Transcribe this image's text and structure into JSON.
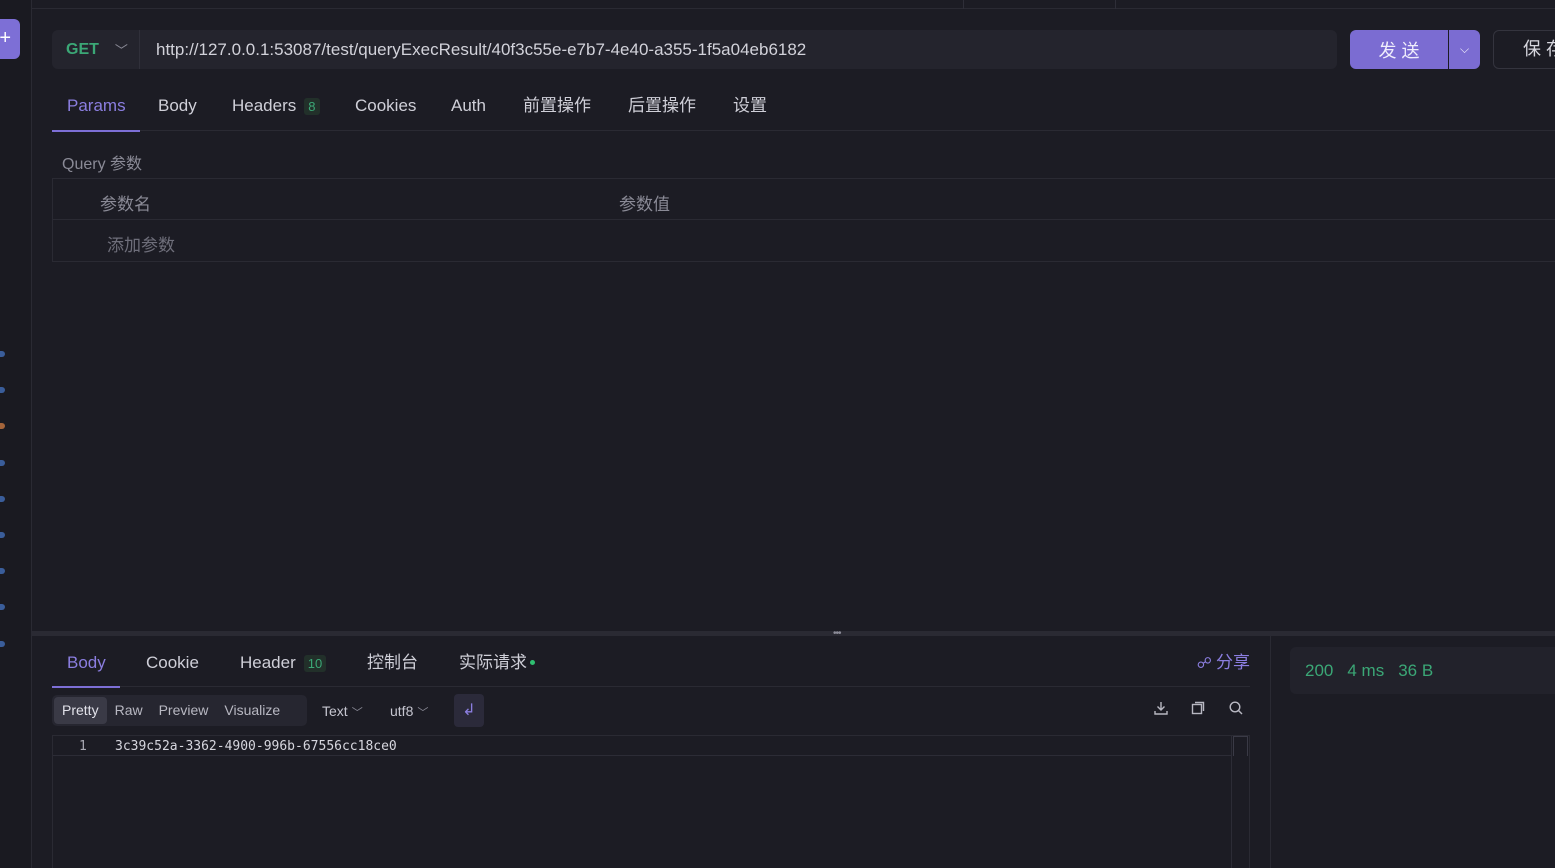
{
  "request": {
    "method": "GET",
    "url": "http://127.0.0.1:53087/test/queryExecResult/40f3c55e-e7b7-4e40-a355-1f5a04eb6182",
    "send_label": "发 送",
    "save_label": "保 存"
  },
  "request_tabs": {
    "params": "Params",
    "body": "Body",
    "headers": "Headers",
    "headers_count": "8",
    "cookies": "Cookies",
    "auth": "Auth",
    "pre_ops": "前置操作",
    "post_ops": "后置操作",
    "settings": "设置"
  },
  "query": {
    "title": "Query 参数",
    "col_name": "参数名",
    "col_value": "参数值",
    "add_placeholder": "添加参数"
  },
  "response_tabs": {
    "body": "Body",
    "cookie": "Cookie",
    "header": "Header",
    "header_count": "10",
    "console": "控制台",
    "actual_request": "实际请求",
    "share": "分享"
  },
  "view_modes": {
    "pretty": "Pretty",
    "raw": "Raw",
    "preview": "Preview",
    "visualize": "Visualize",
    "format": "Text",
    "encoding": "utf8"
  },
  "editor": {
    "line_number": "1",
    "content": "3c39c52a-3362-4900-996b-67556cc18ce0"
  },
  "status": {
    "code": "200",
    "time": "4 ms",
    "size": "36 B"
  },
  "colors": {
    "accent": "#7b6cd2",
    "success": "#3ba776",
    "background": "#1c1c24"
  }
}
